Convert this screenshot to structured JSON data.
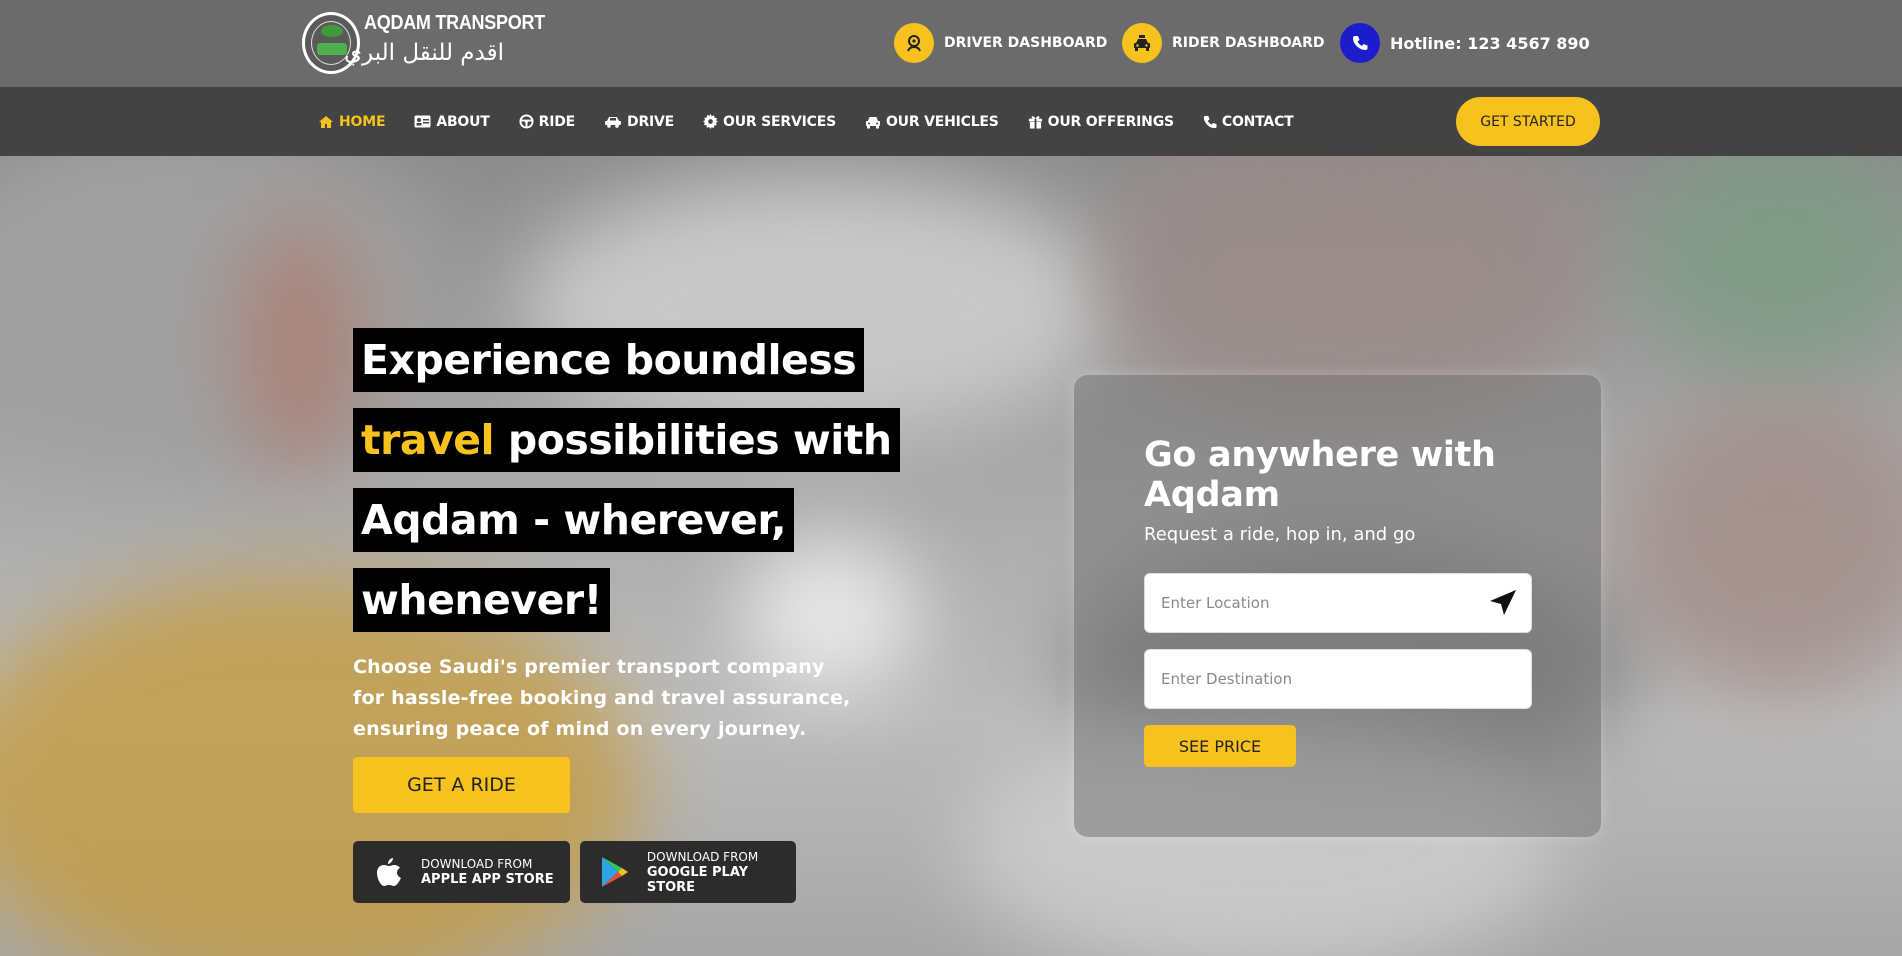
{
  "brand": {
    "name_en": "AQDAM TRANSPORT",
    "name_ar": "اقدم للنقل البري"
  },
  "top_links": {
    "driver_dashboard": "DRIVER DASHBOARD",
    "rider_dashboard": "RIDER DASHBOARD",
    "hotline": "Hotline: 123 4567 890"
  },
  "nav": {
    "items": [
      {
        "label": "HOME",
        "icon": "home-icon"
      },
      {
        "label": "ABOUT",
        "icon": "id-card-icon"
      },
      {
        "label": "RIDE",
        "icon": "steering-wheel-icon"
      },
      {
        "label": "DRIVE",
        "icon": "truck-icon"
      },
      {
        "label": "OUR SERVICES",
        "icon": "gear-icon"
      },
      {
        "label": "OUR VEHICLES",
        "icon": "car-icon"
      },
      {
        "label": "OUR OFFERINGS",
        "icon": "gift-icon"
      },
      {
        "label": "CONTACT",
        "icon": "phone-icon"
      }
    ],
    "cta": "GET STARTED"
  },
  "hero": {
    "headline": {
      "line1": "Experience boundless",
      "line2_highlight": "travel",
      "line2_rest": " possibilities with",
      "line3": "Aqdam - wherever,",
      "line4": "whenever!"
    },
    "subtext": "Choose Saudi's premier transport company for hassle-free booking and travel assurance, ensuring peace of mind on every journey.",
    "cta": "GET A RIDE",
    "stores": {
      "apple": {
        "small": "DOWNLOAD FROM",
        "big": "APPLE APP STORE"
      },
      "google": {
        "small": "DOWNLOAD FROM",
        "big": "GOOGLE PLAY STORE"
      }
    }
  },
  "booking": {
    "title": "Go anywhere with Aqdam",
    "subtitle": "Request a ride, hop in, and go",
    "location_placeholder": "Enter Location",
    "destination_placeholder": "Enter Destination",
    "submit": "SEE PRICE"
  },
  "colors": {
    "accent": "#f7c21e",
    "topbar": "#6b6b6b",
    "nav": "#434343",
    "hotline_icon": "#1c1ccc"
  }
}
